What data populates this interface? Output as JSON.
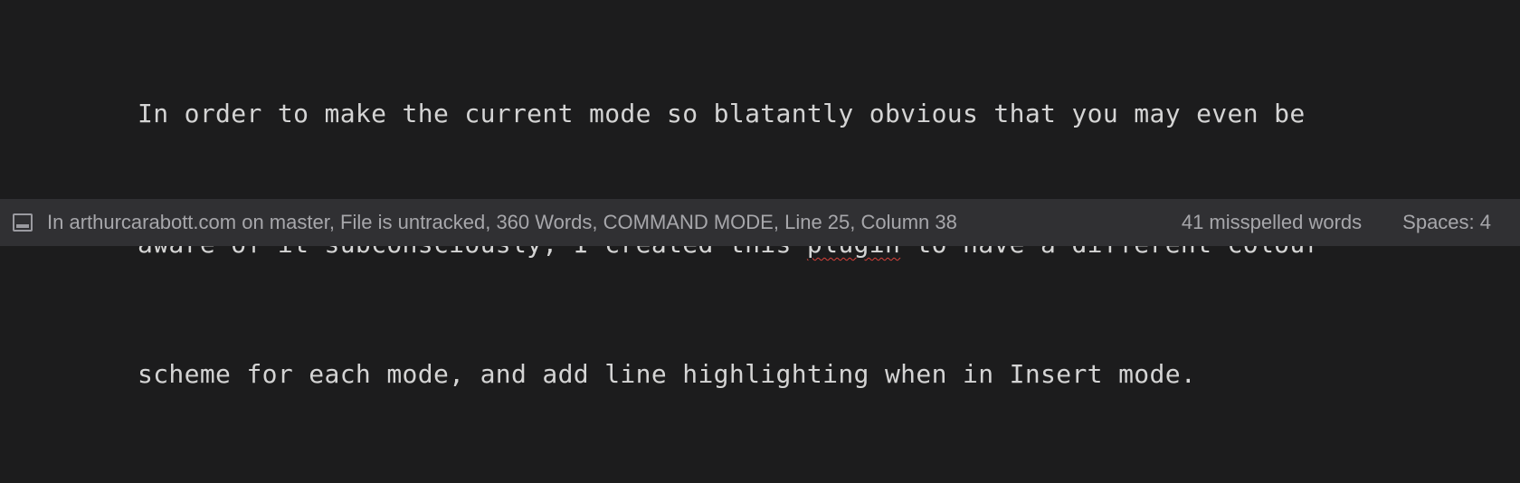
{
  "editor": {
    "lines": [
      {
        "before": "In order to make the current mode so blatantly obvious that you may even be",
        "flagged": "",
        "after": ""
      },
      {
        "before": "aware of it subconsciously, I created this ",
        "flagged": "plugin",
        "after": " to have a different colour"
      },
      {
        "before": "scheme for each mode, and add line highlighting when in Insert mode.",
        "flagged": "",
        "after": ""
      }
    ]
  },
  "status_bar": {
    "panel_icon": "panel-toggle-icon",
    "info": "In arthurcarabott.com on master, File is untracked, 360 Words, COMMAND MODE, Line 25, Column 38",
    "spelling": "41 misspelled words",
    "indentation": "Spaces: 4"
  },
  "colors": {
    "editor_background": "#1c1c1d",
    "text": "#d4d4d4",
    "status_background": "#303033",
    "status_text": "#a7a7ab",
    "spell_error": "#d9423b"
  }
}
